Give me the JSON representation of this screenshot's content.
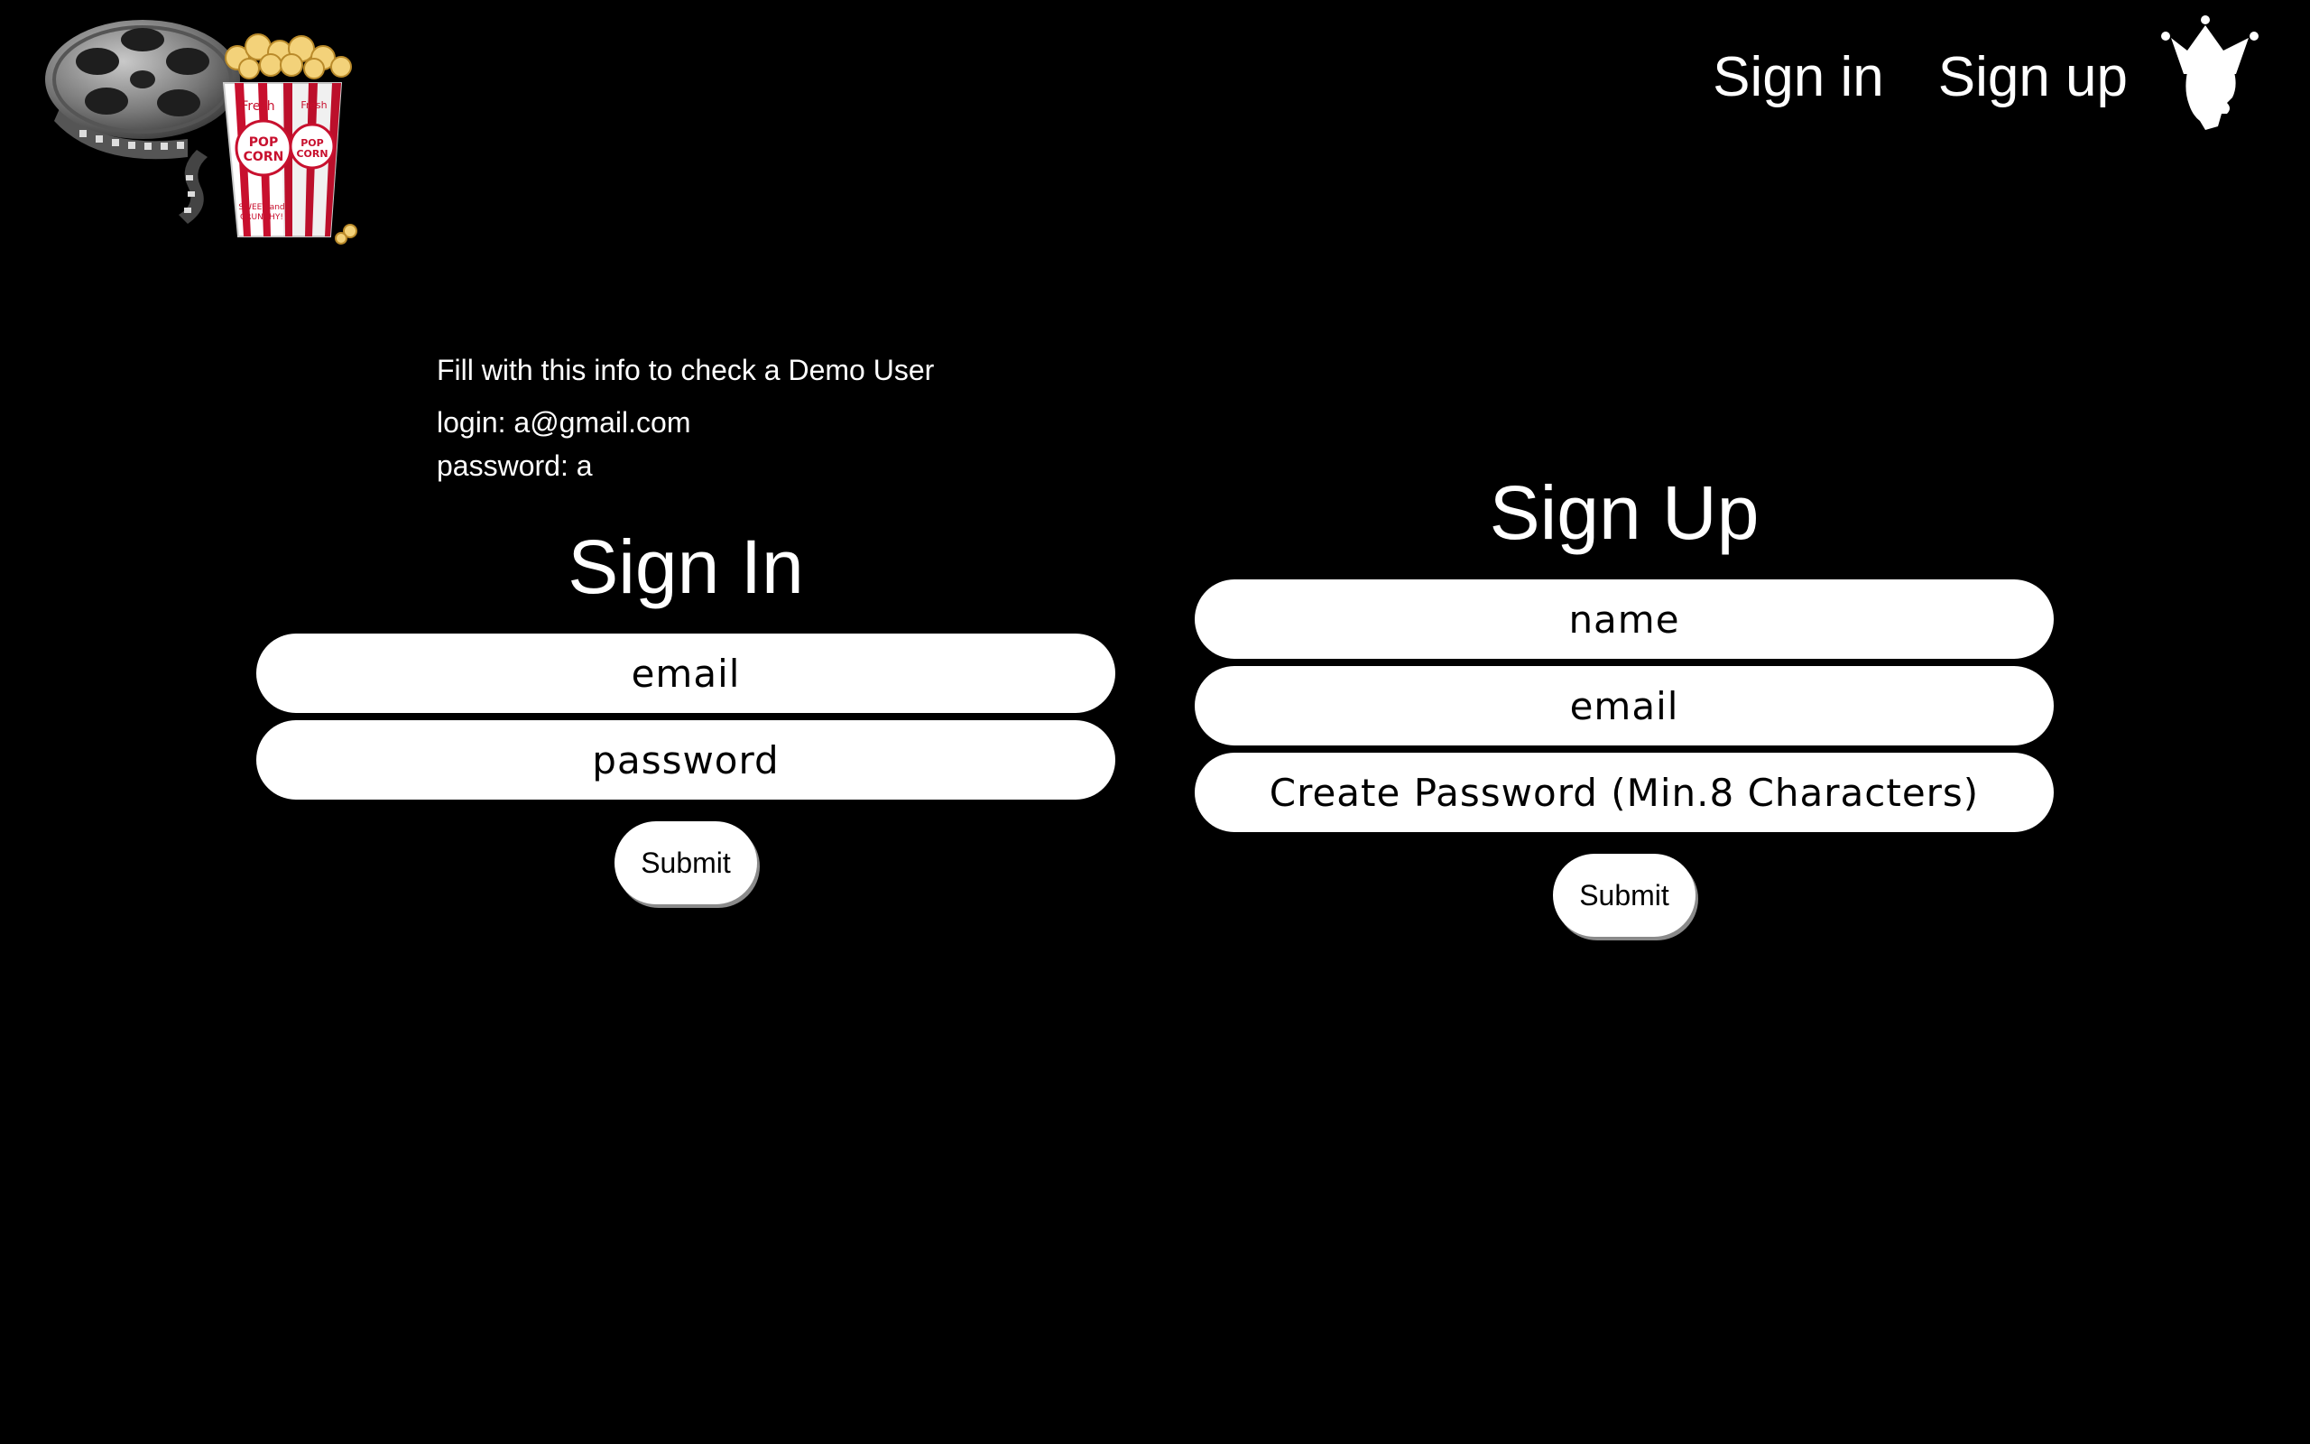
{
  "header": {
    "nav": {
      "sign_in": "Sign in",
      "sign_up": "Sign up"
    },
    "logo": {
      "popcorn_text": [
        "Fresh",
        "POP CORN",
        "SWEET and CRUNCHY!"
      ]
    },
    "icons": {
      "logo": "film-reel-popcorn-logo",
      "profile": "crown-profile-icon"
    }
  },
  "demo": {
    "hint": "Fill with this info to check a Demo User",
    "login_line": "login: a@gmail.com",
    "password_line": "password: a"
  },
  "signin": {
    "title": "Sign In",
    "email_placeholder": "email",
    "password_placeholder": "password",
    "submit_label": "Submit"
  },
  "signup": {
    "title": "Sign Up",
    "name_placeholder": "name",
    "email_placeholder": "email",
    "password_placeholder": "Create Password (Min.8 Characters)",
    "submit_label": "Submit"
  },
  "colors": {
    "background": "#000000",
    "text": "#ffffff",
    "field": "#ffffff",
    "popcorn_stripe": "#c8102e"
  }
}
